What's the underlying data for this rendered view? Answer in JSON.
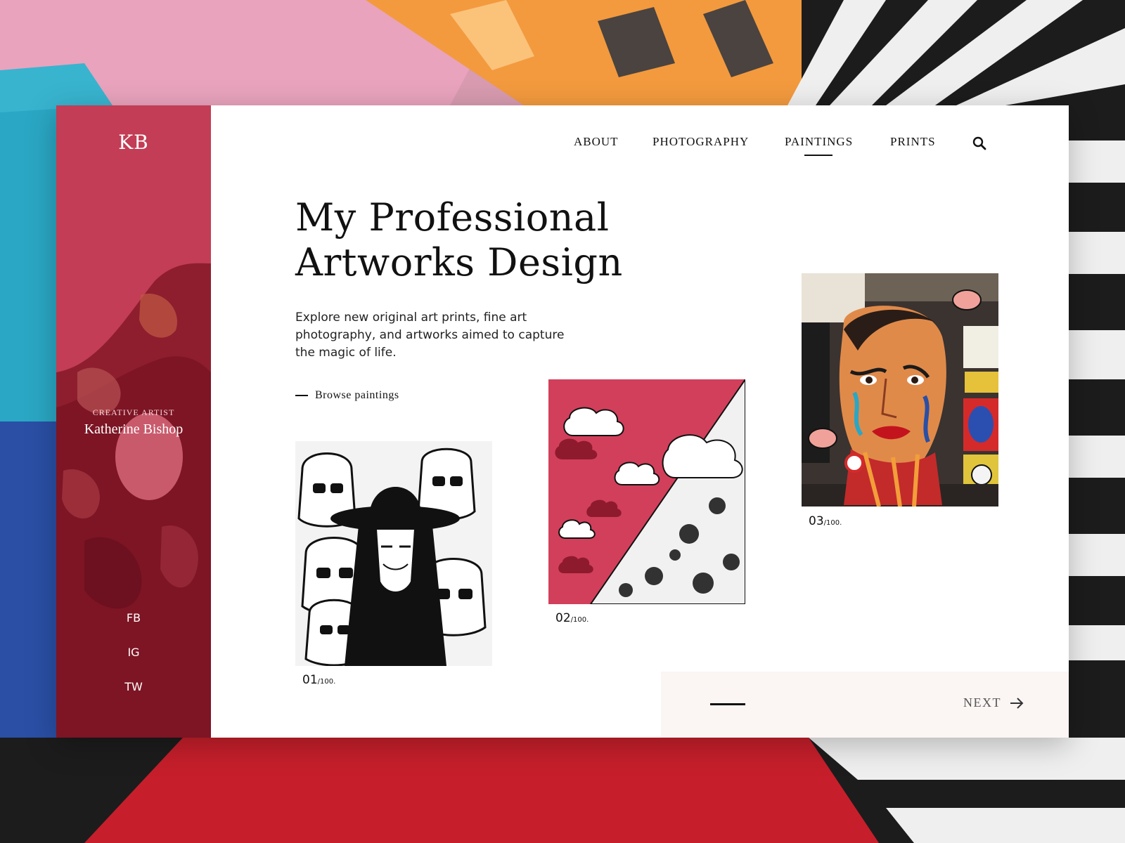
{
  "brand": {
    "logo": "KB",
    "role": "CREATIVE ARTIST",
    "name": "Katherine Bishop"
  },
  "social": [
    "FB",
    "IG",
    "TW"
  ],
  "nav": {
    "items": [
      {
        "label": "ABOUT"
      },
      {
        "label": "PHOTOGRAPHY"
      },
      {
        "label": "PAINTINGS",
        "active": true
      },
      {
        "label": "PRINTS"
      }
    ],
    "search_icon": "search-icon"
  },
  "hero": {
    "title_line1": "My Professional",
    "title_line2": "Artworks Design",
    "description": "Explore new original art prints, fine art photography, and artworks aimed to capture the magic of life.",
    "browse_label": "Browse paintings"
  },
  "artworks": [
    {
      "index": "01",
      "total": "/100."
    },
    {
      "index": "02",
      "total": "/100."
    },
    {
      "index": "03",
      "total": "/100."
    }
  ],
  "pager": {
    "next_label": "NEXT",
    "arrow_icon": "arrow-right-icon"
  },
  "colors": {
    "accent": "#c23d55",
    "pager_bg": "#fbf5f4",
    "text": "#111111"
  }
}
